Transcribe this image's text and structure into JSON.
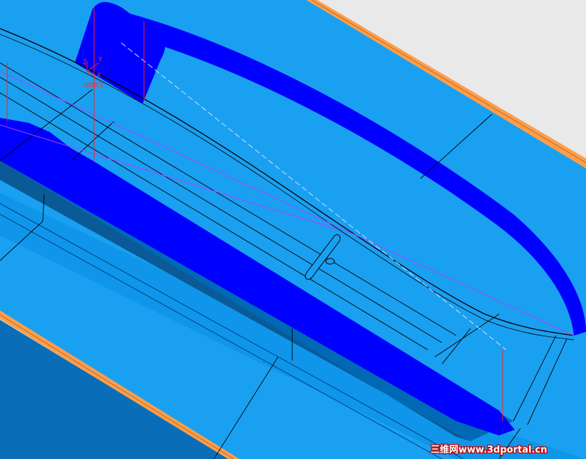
{
  "scene": {
    "colors": {
      "background": "#e9e9e9",
      "orange_edge": "#ff9e4a",
      "surface_light": "#1aa0f0",
      "surface_mid": "#0a8de0",
      "surface_dark": "#0070c0",
      "deep_blue": "#0000ff",
      "edge_line": "#000000",
      "guide_red": "#ff2020",
      "guide_magenta": "#b040ff"
    },
    "triad": {
      "axis_z": "Z",
      "axis_y": "Y",
      "axis_x": "X",
      "origin_code": "UOBCS"
    }
  },
  "watermark": {
    "text": "三维网www.3dportal.cn"
  }
}
